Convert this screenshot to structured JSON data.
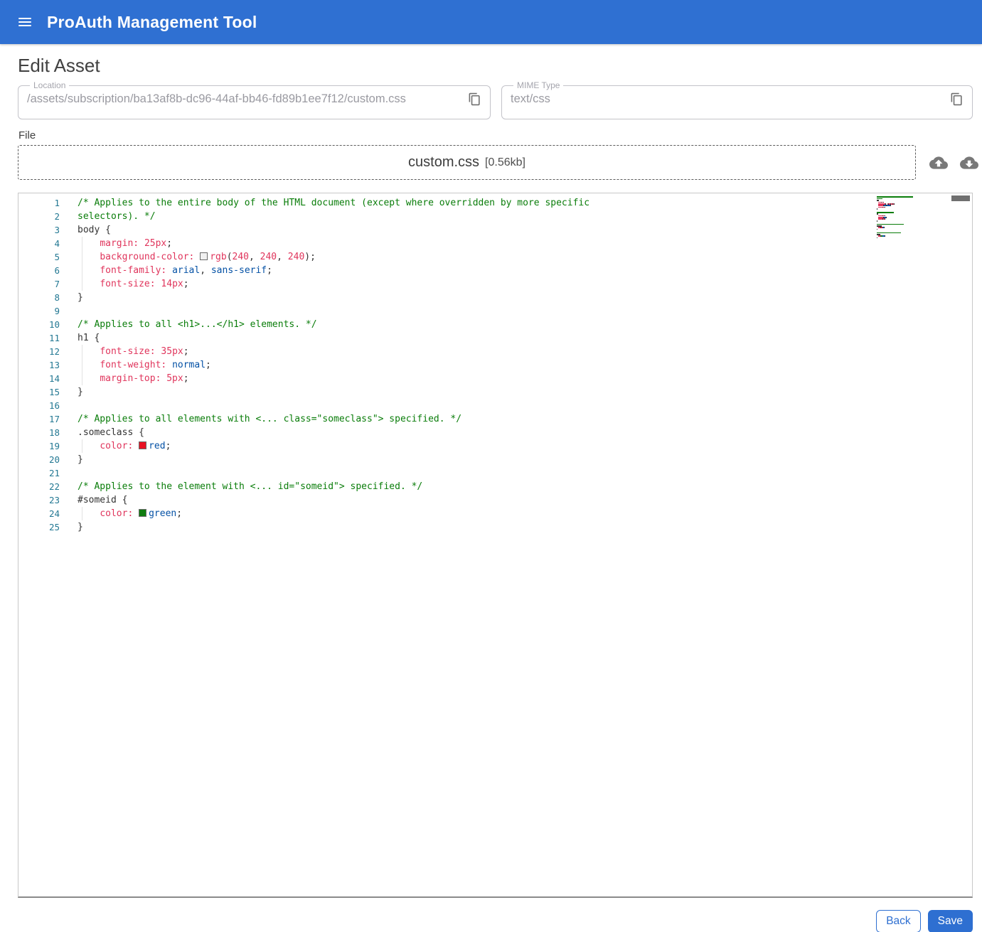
{
  "header": {
    "title": "ProAuth Management Tool",
    "accent_color": "#2f70d2"
  },
  "page": {
    "title": "Edit Asset"
  },
  "fields": {
    "location": {
      "label": "Location",
      "value": "/assets/subscription/ba13af8b-dc96-44af-bb46-fd89b1ee7f12/custom.css"
    },
    "mime": {
      "label": "MIME Type",
      "value": "text/css"
    }
  },
  "file": {
    "label": "File",
    "name": "custom.css",
    "size": "[0.56kb]"
  },
  "editor": {
    "line_number_color": "#237893",
    "colors": {
      "cm": "#0a7d0a",
      "pl": "#333333",
      "pr": "#e0355c",
      "vb": "#0451a5",
      "sp": "#333333"
    },
    "lines": [
      {
        "n": 1,
        "seg": [
          [
            "cm",
            "/* Applies to the entire body of the HTML document (except where overridden by more specific"
          ]
        ]
      },
      {
        "n": 2,
        "seg": [
          [
            "cm",
            "selectors). */"
          ]
        ]
      },
      {
        "n": 3,
        "seg": [
          [
            "pl",
            "body {"
          ]
        ]
      },
      {
        "n": 4,
        "guide": true,
        "seg": [
          [
            "sp",
            "    "
          ],
          [
            "pr",
            "margin:"
          ],
          [
            "pl",
            " "
          ],
          [
            "pr",
            "25px"
          ],
          [
            "pl",
            ";"
          ]
        ]
      },
      {
        "n": 5,
        "guide": true,
        "seg": [
          [
            "sp",
            "    "
          ],
          [
            "pr",
            "background-color:"
          ],
          [
            "pl",
            " "
          ],
          [
            "sw",
            "#f0f0f0"
          ],
          [
            "pr",
            "rgb"
          ],
          [
            "pl",
            "("
          ],
          [
            "pr",
            "240"
          ],
          [
            "pl",
            ", "
          ],
          [
            "pr",
            "240"
          ],
          [
            "pl",
            ", "
          ],
          [
            "pr",
            "240"
          ],
          [
            "pl",
            ");"
          ]
        ]
      },
      {
        "n": 6,
        "guide": true,
        "seg": [
          [
            "sp",
            "    "
          ],
          [
            "pr",
            "font-family:"
          ],
          [
            "pl",
            " "
          ],
          [
            "vb",
            "arial"
          ],
          [
            "pl",
            ", "
          ],
          [
            "vb",
            "sans-serif"
          ],
          [
            "pl",
            ";"
          ]
        ]
      },
      {
        "n": 7,
        "guide": true,
        "seg": [
          [
            "sp",
            "    "
          ],
          [
            "pr",
            "font-size:"
          ],
          [
            "pl",
            " "
          ],
          [
            "pr",
            "14px"
          ],
          [
            "pl",
            ";"
          ]
        ]
      },
      {
        "n": 8,
        "seg": [
          [
            "pl",
            "}"
          ]
        ]
      },
      {
        "n": 9,
        "seg": []
      },
      {
        "n": 10,
        "seg": [
          [
            "cm",
            "/* Applies to all <h1>...</h1> elements. */"
          ]
        ]
      },
      {
        "n": 11,
        "seg": [
          [
            "pl",
            "h1 {"
          ]
        ]
      },
      {
        "n": 12,
        "guide": true,
        "seg": [
          [
            "sp",
            "    "
          ],
          [
            "pr",
            "font-size:"
          ],
          [
            "pl",
            " "
          ],
          [
            "pr",
            "35px"
          ],
          [
            "pl",
            ";"
          ]
        ]
      },
      {
        "n": 13,
        "guide": true,
        "seg": [
          [
            "sp",
            "    "
          ],
          [
            "pr",
            "font-weight:"
          ],
          [
            "pl",
            " "
          ],
          [
            "vb",
            "normal"
          ],
          [
            "pl",
            ";"
          ]
        ]
      },
      {
        "n": 14,
        "guide": true,
        "seg": [
          [
            "sp",
            "    "
          ],
          [
            "pr",
            "margin-top:"
          ],
          [
            "pl",
            " "
          ],
          [
            "pr",
            "5px"
          ],
          [
            "pl",
            ";"
          ]
        ]
      },
      {
        "n": 15,
        "seg": [
          [
            "pl",
            "}"
          ]
        ]
      },
      {
        "n": 16,
        "seg": []
      },
      {
        "n": 17,
        "seg": [
          [
            "cm",
            "/* Applies to all elements with <... class=\"someclass\"> specified. */"
          ]
        ]
      },
      {
        "n": 18,
        "seg": [
          [
            "pl",
            ".someclass {"
          ]
        ]
      },
      {
        "n": 19,
        "guide": true,
        "seg": [
          [
            "sp",
            "    "
          ],
          [
            "pr",
            "color:"
          ],
          [
            "pl",
            " "
          ],
          [
            "sw",
            "#e81123"
          ],
          [
            "vb",
            "red"
          ],
          [
            "pl",
            ";"
          ]
        ]
      },
      {
        "n": 20,
        "seg": [
          [
            "pl",
            "}"
          ]
        ]
      },
      {
        "n": 21,
        "seg": []
      },
      {
        "n": 22,
        "seg": [
          [
            "cm",
            "/* Applies to the element with <... id=\"someid\"> specified. */"
          ]
        ]
      },
      {
        "n": 23,
        "seg": [
          [
            "pl",
            "#someid {"
          ]
        ]
      },
      {
        "n": 24,
        "guide": true,
        "seg": [
          [
            "sp",
            "    "
          ],
          [
            "pr",
            "color:"
          ],
          [
            "pl",
            " "
          ],
          [
            "sw",
            "#107c10"
          ],
          [
            "vb",
            "green"
          ],
          [
            "pl",
            ";"
          ]
        ]
      },
      {
        "n": 25,
        "seg": [
          [
            "pl",
            "}"
          ]
        ]
      }
    ]
  },
  "buttons": {
    "back": "Back",
    "save": "Save"
  }
}
